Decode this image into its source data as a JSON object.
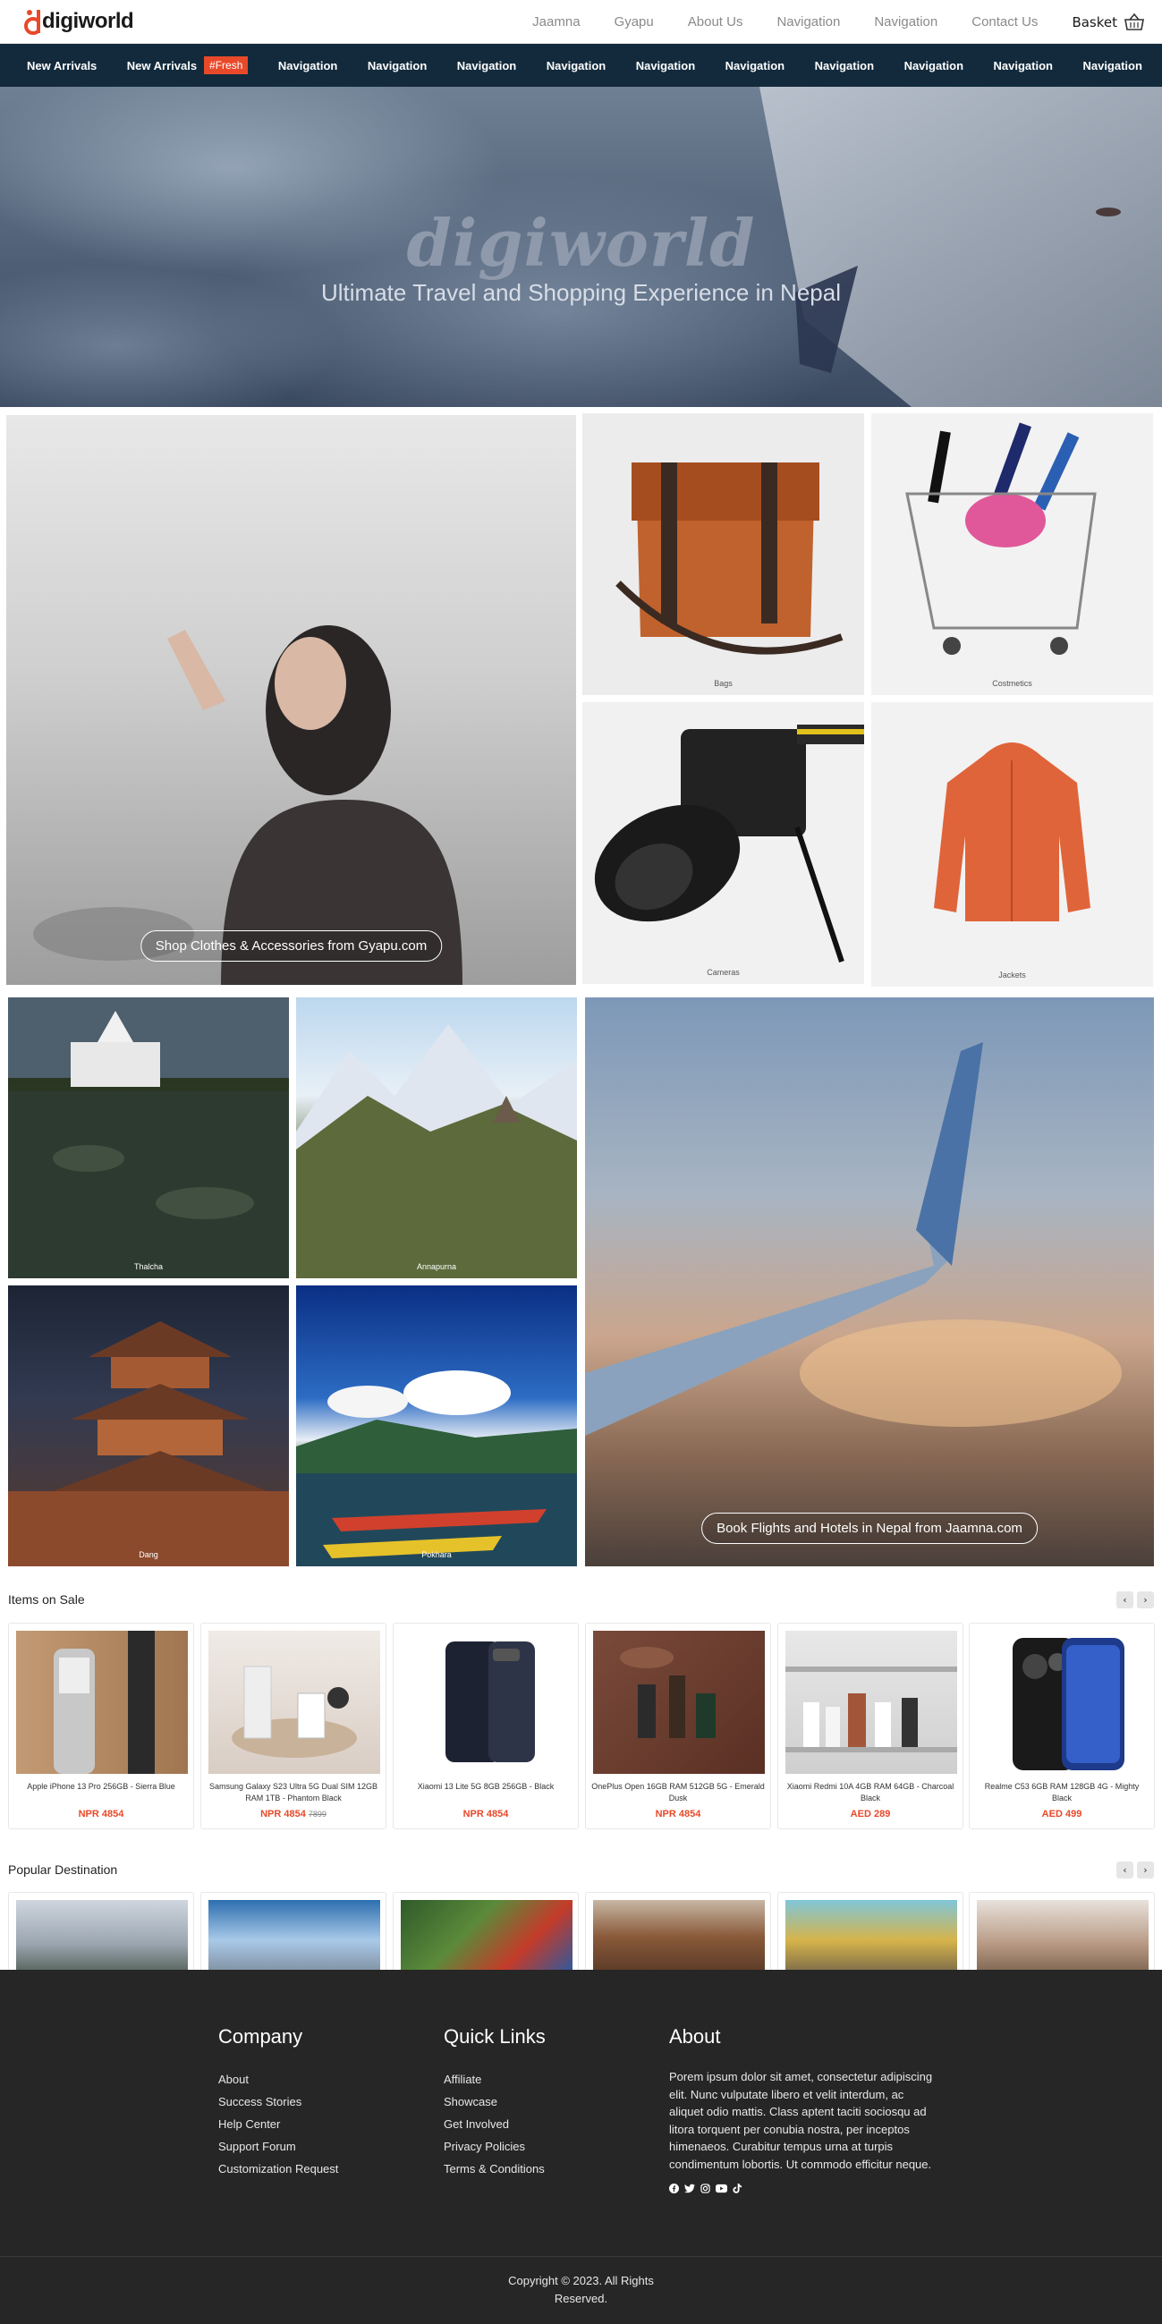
{
  "header": {
    "logo_text": "digiworld",
    "nav": [
      "Jaamna",
      "Gyapu",
      "About Us",
      "Navigation",
      "Navigation",
      "Contact Us"
    ],
    "basket_label": "Basket"
  },
  "catnav": {
    "items": [
      "New Arrivals",
      "New Arrivals",
      "Navigation",
      "Navigation",
      "Navigation",
      "Navigation",
      "Navigation",
      "Navigation",
      "Navigation",
      "Navigation",
      "Navigation",
      "Navigation"
    ],
    "badge": "#Fresh"
  },
  "hero": {
    "title": "digiworld",
    "subtitle": "Ultimate Travel and Shopping Experience in Nepal"
  },
  "shop": {
    "cta": "Shop Clothes & Accessories from Gyapu.com",
    "categories": [
      "Bags",
      "Costmetics",
      "Cameras",
      "Jackets"
    ]
  },
  "travel": {
    "places": [
      "Thalcha",
      "Annapurna",
      "Dang",
      "Pokhara"
    ],
    "cta": "Book Flights and Hotels in Nepal from Jaamna.com"
  },
  "sale": {
    "title": "Items on Sale",
    "items": [
      {
        "name": "Apple iPhone 13 Pro 256GB - Sierra Blue",
        "price": "NPR 4854",
        "old_price": ""
      },
      {
        "name": "Samsung Galaxy S23 Ultra 5G Dual SIM 12GB RAM 1TB - Phantom Black",
        "price": "NPR 4854",
        "old_price": "7899"
      },
      {
        "name": "Xiaomi 13 Lite 5G 8GB 256GB - Black",
        "price": "NPR 4854",
        "old_price": ""
      },
      {
        "name": "OnePlus Open 16GB RAM 512GB 5G - Emerald Dusk",
        "price": "NPR 4854",
        "old_price": ""
      },
      {
        "name": "Xiaomi Redmi 10A 4GB RAM 64GB - Charcoal Black",
        "price": "AED 289",
        "old_price": ""
      },
      {
        "name": "Realme C53 6GB RAM 128GB 4G - Mighty Black",
        "price": "AED 499",
        "old_price": ""
      }
    ]
  },
  "destinations": {
    "title": "Popular Destination"
  },
  "footer": {
    "company": {
      "title": "Company",
      "links": [
        "About",
        "Success Stories",
        "Help Center",
        "Support Forum",
        "Customization Request"
      ]
    },
    "quick": {
      "title": "Quick Links",
      "links": [
        "Affiliate",
        "Showcase",
        "Get Involved",
        "Privacy Policies",
        "Terms & Conditions"
      ]
    },
    "about": {
      "title": "About",
      "text": "Porem ipsum dolor sit amet, consectetur adipiscing elit. Nunc vulputate libero et velit interdum, ac aliquet odio mattis. Class aptent taciti sociosqu ad litora torquent per conubia nostra, per inceptos himenaeos. Curabitur tempus urna at turpis condimentum lobortis. Ut commodo efficitur neque."
    },
    "socials": [
      "facebook-icon",
      "twitter-icon",
      "instagram-icon",
      "youtube-icon",
      "tiktok-icon"
    ],
    "copyright_1": "Copyright © 2023. All Rights",
    "copyright_2": "Reserved."
  },
  "colors": {
    "accent": "#e8492a",
    "nav_bg": "#122a3c",
    "footer_bg": "#262626"
  }
}
